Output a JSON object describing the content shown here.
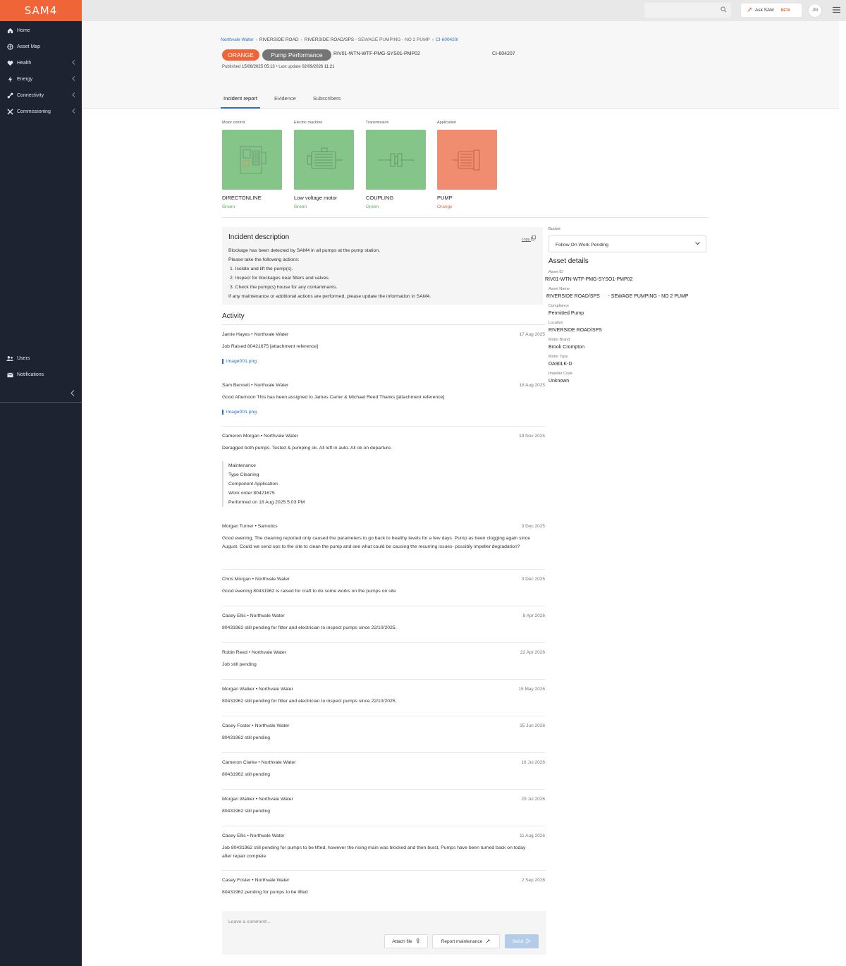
{
  "app": {
    "logo": "SAM4"
  },
  "sidebar": {
    "items": [
      {
        "label": "Home",
        "icon": "home-icon"
      },
      {
        "label": "Asset Map",
        "icon": "globe-icon"
      },
      {
        "label": "Health",
        "icon": "heart-icon"
      },
      {
        "label": "Energy",
        "icon": "bolt-icon"
      },
      {
        "label": "Connectivity",
        "icon": "connection-icon"
      },
      {
        "label": "Commissioning",
        "icon": "tools-icon"
      }
    ],
    "bottom": [
      {
        "label": "Users",
        "icon": "users-icon"
      },
      {
        "label": "Notifications",
        "icon": "mail-icon"
      }
    ]
  },
  "topbar": {
    "ask_label": "Ask SAM",
    "beta": "BETA",
    "avatar": "JM"
  },
  "breadcrumb": {
    "org": "Northvale Water",
    "site": "RIVERSIDE ROAD",
    "station": "RIVERSIDE ROAD/SPS",
    "asset_desc": "- SEWAGE PUMPING - NO 2 PUMP",
    "ci": "CI-600420/"
  },
  "status": {
    "level": "ORANGE",
    "category": "Pump Performance",
    "asset_code": "RIV01-WTN-WTF-PMG-SYS01-PMP02",
    "ci_id": "CI-604207"
  },
  "published": {
    "label": "Published",
    "date": "15/08/2025 05:13",
    "update_label": "Last update",
    "update_date": "02/09/2026 11:21"
  },
  "tabs": [
    "Incident report",
    "Evidence",
    "Subscribers"
  ],
  "components": [
    {
      "category": "Motor control",
      "name": "DIRECTONLINE",
      "status": "Green",
      "color": "#86c58a"
    },
    {
      "category": "Electric machine",
      "name": "Low voltage motor",
      "status": "Green",
      "color": "#86c58a"
    },
    {
      "category": "Transmission",
      "name": "COUPLING",
      "status": "Green",
      "color": "#86c58a"
    },
    {
      "category": "Application",
      "name": "PUMP",
      "status": "Orange",
      "color": "#f08c6f"
    }
  ],
  "status_colors": {
    "Green": "#4caf50",
    "Orange": "#ef6538"
  },
  "incident": {
    "title": "Incident description",
    "copy_label": "copy",
    "lines": [
      "Blockage has been detected by SAM4 in all pumps at the pump station.",
      "Please take the following actions:",
      "1. Isolate and lift the pump(s).",
      "2. Inspect for blockages near filters and valves.",
      "3. Check the pump(s) house for any contaminants.",
      "If any maintenance or additional actions are performed, please update the information in SAM4."
    ]
  },
  "activity": {
    "title": "Activity",
    "entries": [
      {
        "who": "Jamie Hayes • Northvale Water",
        "date": "17 Aug 2025",
        "msg": "Job Raised 80421675 [attachment reference]",
        "attachment": "image001.png"
      },
      {
        "who": "Sam Bennett • Northvale Water",
        "date": "18 Aug 2025",
        "msg": "Good Afternoon This has been assigned to James Carter & Michael Reed Thanks [attachment reference]",
        "attachment": "image001.png"
      },
      {
        "who": "Cameron Morgan • Northvale Water",
        "date": "18 Nov 2025",
        "msg": "Deragged both pumps. Tested & pumping ok. All left in auto. All ok on departure.",
        "maintenance": [
          "Maintenance",
          "Type  Cleaning",
          "Component  Application",
          "Work order  80421675",
          "Performed on  18 Aug 2025 5:03 PM"
        ]
      },
      {
        "who": "Morgan Turner • Samotics",
        "date": "3 Dec 2025",
        "msg": "Good evening, The cleaning reported only caused the parameters to go back to healthy levels for a few days. Pump as been clogging again since August. Could we send ops to the site to clean the pump and see what could be causing the recurring issues- possibly impeller degradation?"
      },
      {
        "who": "Chris Morgan • Northvale Water",
        "date": "3 Dec 2025",
        "msg": "Good evening 80431962 is raised for craft to do some works on the pumps on site"
      },
      {
        "who": "Casey Ellis • Northvale Water",
        "date": "8 Apr 2026",
        "msg": "80431962 still pending for fitter and electrician to inspect pumps since 22/10/2025."
      },
      {
        "who": "Robin Reed • Northvale Water",
        "date": "22 Apr 2026",
        "msg": "Job still pending"
      },
      {
        "who": "Morgan Walker • Northvale Water",
        "date": "15 May 2026",
        "msg": "80431962 still pending for fitter and electrician to inspect pumps since 22/10/2025."
      },
      {
        "who": "Casey Foster • Northvale Water",
        "date": "25 Jun 2026",
        "msg": "80431962 still pending"
      },
      {
        "who": "Cameron Clarke • Northvale Water",
        "date": "16 Jul 2026",
        "msg": "80431962 still pending"
      },
      {
        "who": "Morgan Walker • Northvale Water",
        "date": "29 Jul 2026",
        "msg": "80431962 still pending"
      },
      {
        "who": "Casey Ellis • Northvale Water",
        "date": "11 Aug 2026",
        "msg": "Job 80431962 still pending for pumps to be lifted, however the rising main was blocked and then burst, Pumps have been turned back on today after repair complete"
      },
      {
        "who": "Casey Foster • Northvale Water",
        "date": "2 Sep 2026",
        "msg": "80431962 pending for pumps to be lifted"
      }
    ]
  },
  "comment": {
    "placeholder": "Leave a comment...",
    "attach": "Attach file",
    "report": "Report maintenance",
    "send": "Send"
  },
  "bucket": {
    "label": "Bucket",
    "value": "Follow On Work Pending"
  },
  "asset_details": {
    "title": "Asset details",
    "fields": [
      {
        "k": "Asset ID",
        "v": "RIV01-WTN-WTF-PMG-SYSO1-PMP02"
      },
      {
        "k": "Asset Name",
        "v": "RIVERSIDE ROAD/SPS      - SEWAGE PUMPING - NO 2 PUMP"
      },
      {
        "k": "Compliance",
        "v": "Permitted Pump"
      },
      {
        "k": "Location",
        "v": "RIVERSIDE ROAD/SPS"
      },
      {
        "k": "Motor Brand",
        "v": "Brook Crompton"
      },
      {
        "k": "Motor Type",
        "v": "DA90LK-D"
      },
      {
        "k": "Impeller Code",
        "v": "Unknown"
      }
    ]
  }
}
